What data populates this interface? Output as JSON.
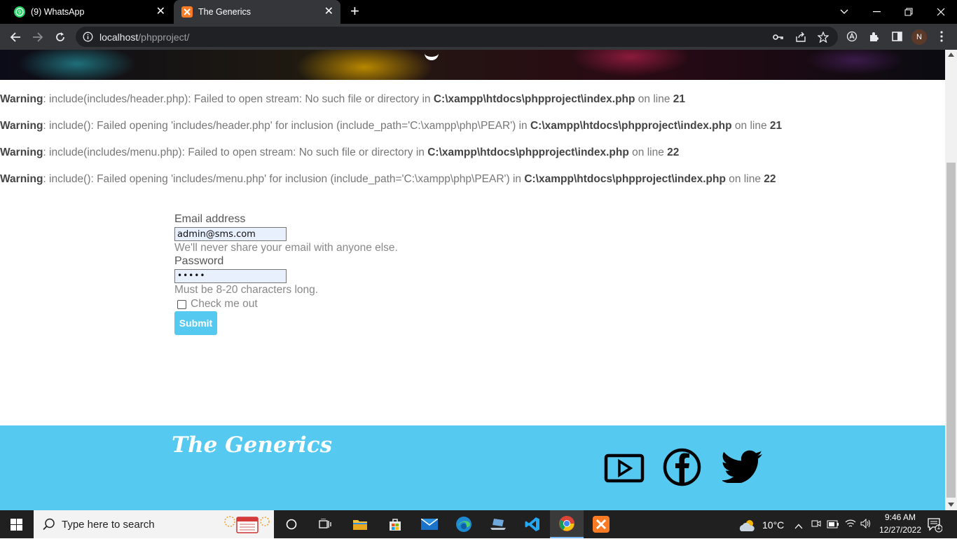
{
  "browser": {
    "tabs": [
      {
        "title": "(9) WhatsApp",
        "icon": "whatsapp-icon",
        "badge": "9",
        "active": false
      },
      {
        "title": "The Generics",
        "icon": "xampp-icon",
        "active": true
      }
    ],
    "url_host": "localhost",
    "url_path": "/phpproject/",
    "profile_initial": "N"
  },
  "warnings": [
    {
      "label": "Warning",
      "message": ": include(includes/header.php): Failed to open stream: No such file or directory in ",
      "file": "C:\\xampp\\htdocs\\phpproject\\index.php",
      "on_line": " on line ",
      "line": "21"
    },
    {
      "label": "Warning",
      "message": ": include(): Failed opening 'includes/header.php' for inclusion (include_path='C:\\xampp\\php\\PEAR') in ",
      "file": "C:\\xampp\\htdocs\\phpproject\\index.php",
      "on_line": " on line ",
      "line": "21"
    },
    {
      "label": "Warning",
      "message": ": include(includes/menu.php): Failed to open stream: No such file or directory in ",
      "file": "C:\\xampp\\htdocs\\phpproject\\index.php",
      "on_line": " on line ",
      "line": "22"
    },
    {
      "label": "Warning",
      "message": ": include(): Failed opening 'includes/menu.php' for inclusion (include_path='C:\\xampp\\php\\PEAR') in ",
      "file": "C:\\xampp\\htdocs\\phpproject\\index.php",
      "on_line": " on line ",
      "line": "22"
    }
  ],
  "form": {
    "email_label": "Email address",
    "email_value": "admin@sms.com",
    "email_help": "We'll never share your email with anyone else.",
    "password_label": "Password",
    "password_value": "•••••",
    "password_help": "Must be 8-20 characters long.",
    "checkbox_label": "Check me out",
    "submit_label": "Submit"
  },
  "footer": {
    "brand": "The Generics",
    "social": [
      "youtube-icon",
      "facebook-icon",
      "twitter-icon"
    ]
  },
  "taskbar": {
    "search_placeholder": "Type here to search",
    "weather": "10°C",
    "time": "9:46 AM",
    "date": "12/27/2022",
    "notification_count": "1"
  },
  "colors": {
    "accent": "#56c9f0",
    "browser_frame": "#000000",
    "toolbar": "#35363a",
    "taskbar": "#202020"
  }
}
